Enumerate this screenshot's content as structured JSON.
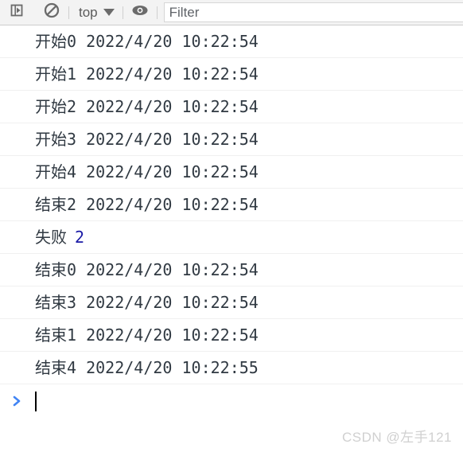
{
  "toolbar": {
    "execute_button": {
      "icon": "step-execute-icon",
      "title": "Execute"
    },
    "clear_button": {
      "icon": "clear-console-icon",
      "title": "Clear console"
    },
    "context_selector": {
      "label": "top",
      "icon": "chevron-down-icon"
    },
    "eye_button": {
      "icon": "eye-icon",
      "title": "Create live expression"
    },
    "filter": {
      "value": "",
      "placeholder": "Filter"
    }
  },
  "console": {
    "messages": [
      {
        "text": "开始0 2022/4/20 10:22:54",
        "type": "log"
      },
      {
        "text": "开始1 2022/4/20 10:22:54",
        "type": "log"
      },
      {
        "text": "开始2 2022/4/20 10:22:54",
        "type": "log"
      },
      {
        "text": "开始3 2022/4/20 10:22:54",
        "type": "log"
      },
      {
        "text": "开始4 2022/4/20 10:22:54",
        "type": "log"
      },
      {
        "text": "结束2 2022/4/20 10:22:54",
        "type": "log"
      },
      {
        "text": "失败",
        "value": "2",
        "type": "log-with-number"
      },
      {
        "text": "结束0 2022/4/20 10:22:54",
        "type": "log"
      },
      {
        "text": "结束3 2022/4/20 10:22:54",
        "type": "log"
      },
      {
        "text": "结束1 2022/4/20 10:22:54",
        "type": "log"
      },
      {
        "text": "结束4 2022/4/20 10:22:55",
        "type": "log"
      }
    ]
  },
  "prompt": {
    "chevron": "chevron-right-icon",
    "input_value": ""
  },
  "watermark": {
    "text": "CSDN @左手121"
  },
  "colors": {
    "toolbar_background": "#f3f3f3",
    "toolbar_border": "#cdcdcd",
    "message_text": "#303942",
    "number_literal": "#1a1aa6",
    "prompt_chevron": "#4285f4",
    "row_divider": "#f0f0f0",
    "watermark": "#d0d0d0"
  }
}
